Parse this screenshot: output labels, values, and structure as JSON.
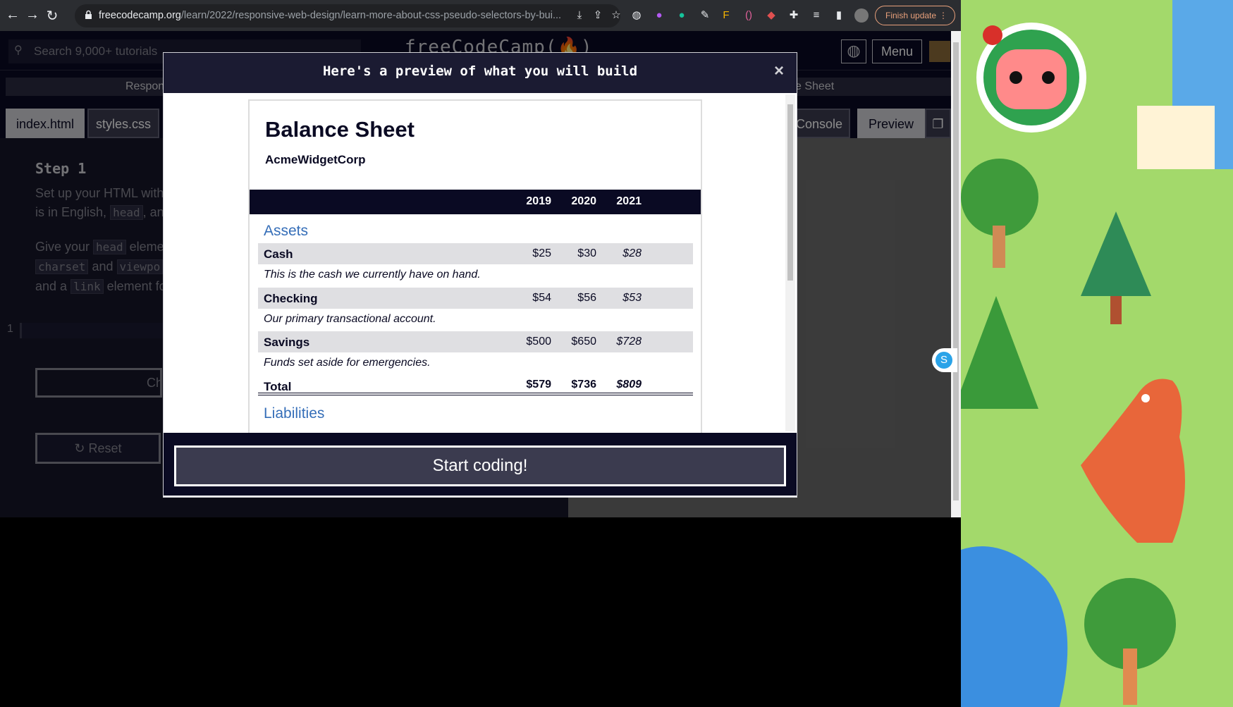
{
  "browser": {
    "url_domain": "freecodecamp.org",
    "url_path": "/learn/2022/responsive-web-design/learn-more-about-css-pseudo-selectors-by-bui...",
    "finish_update_label": "Finish update"
  },
  "fcc": {
    "search_placeholder": "Search 9,000+ tutorials",
    "logo": "freeCodeCamp(🔥)",
    "menu_label": "Menu",
    "breadcrumb_left": "Respon",
    "breadcrumb_right": "e Sheet",
    "tabs": {
      "index": "index.html",
      "styles": "styles.css",
      "console": "Console",
      "preview": "Preview"
    },
    "step_title": "Step 1",
    "desc_line1": "Set up your HTML with",
    "desc_line2_a": "is in English,",
    "desc_line2_code": "head",
    "desc_line2_b": ", an",
    "desc_line3_a": "Give your",
    "desc_line3_code": "head",
    "desc_line3_b": "eleme",
    "desc_line4_code1": "charset",
    "desc_line4_mid": "and",
    "desc_line4_code2": "viewpo",
    "desc_line5_a": "and a",
    "desc_line5_code": "link",
    "desc_line5_b": "element fo",
    "line_number": "1",
    "check_label": "Ch",
    "reset_label": "Reset"
  },
  "modal": {
    "title": "Here's a preview of what you will build",
    "close": "×",
    "start_label": "Start coding!"
  },
  "sheet": {
    "title": "Balance Sheet",
    "company": "AcmeWidgetCorp",
    "years": [
      "2019",
      "2020",
      "2021"
    ],
    "assets_heading": "Assets",
    "rows": [
      {
        "label": "Cash",
        "values": [
          "$25",
          "$30",
          "$28"
        ],
        "note": "This is the cash we currently have on hand."
      },
      {
        "label": "Checking",
        "values": [
          "$54",
          "$56",
          "$53"
        ],
        "note": "Our primary transactional account."
      },
      {
        "label": "Savings",
        "values": [
          "$500",
          "$650",
          "$728"
        ],
        "note": "Funds set aside for emergencies."
      }
    ],
    "total": {
      "label": "Total",
      "values": [
        "$579",
        "$736",
        "$809"
      ]
    },
    "liabilities_heading": "Liabilities"
  },
  "side": {
    "skype_letter": "S"
  }
}
